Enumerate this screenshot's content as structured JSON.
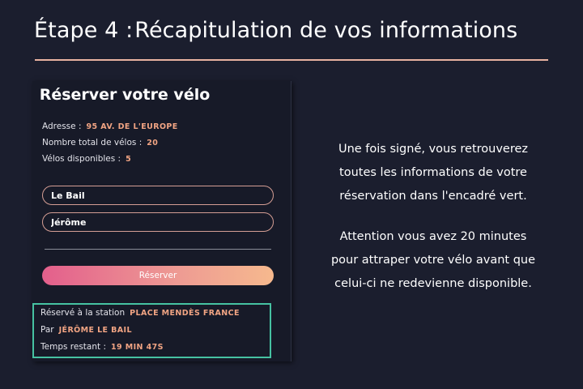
{
  "header": {
    "step_label": "Étape 4 :",
    "title": "Récapitulation de vos informations"
  },
  "form": {
    "title": "Réserver votre vélo",
    "address_label": "Adresse :",
    "address_value": "95 AV. DE L'EUROPE",
    "total_label": "Nombre total de vélos :",
    "total_value": "20",
    "available_label": "Vélos disponibles :",
    "available_value": "5",
    "last_name_value": "Le Bail",
    "first_name_value": "Jérôme",
    "reserve_button": "Réserver"
  },
  "reservation": {
    "station_label": "Réservé à la station",
    "station_value": "PLACE MENDÈS FRANCE",
    "by_label": "Par",
    "by_value": "JÉRÔME LE BAIL",
    "time_label": "Temps restant :",
    "time_value": "19 MIN 47S",
    "border_color": "#46c2a2"
  },
  "instructions": {
    "paragraph1": [
      "Une fois signé, vous retrouverez",
      "toutes les informations de votre",
      "réservation dans l'encadré vert."
    ],
    "paragraph2": [
      "Attention vous avez 20 minutes",
      "pour attraper votre vélo avant que",
      "celui-ci ne redevienne disponible."
    ]
  },
  "colors": {
    "background": "#1b1e2e",
    "accent_value": "#f1a483",
    "button_gradient_start": "#e35f8c",
    "button_gradient_end": "#f6b98e"
  }
}
